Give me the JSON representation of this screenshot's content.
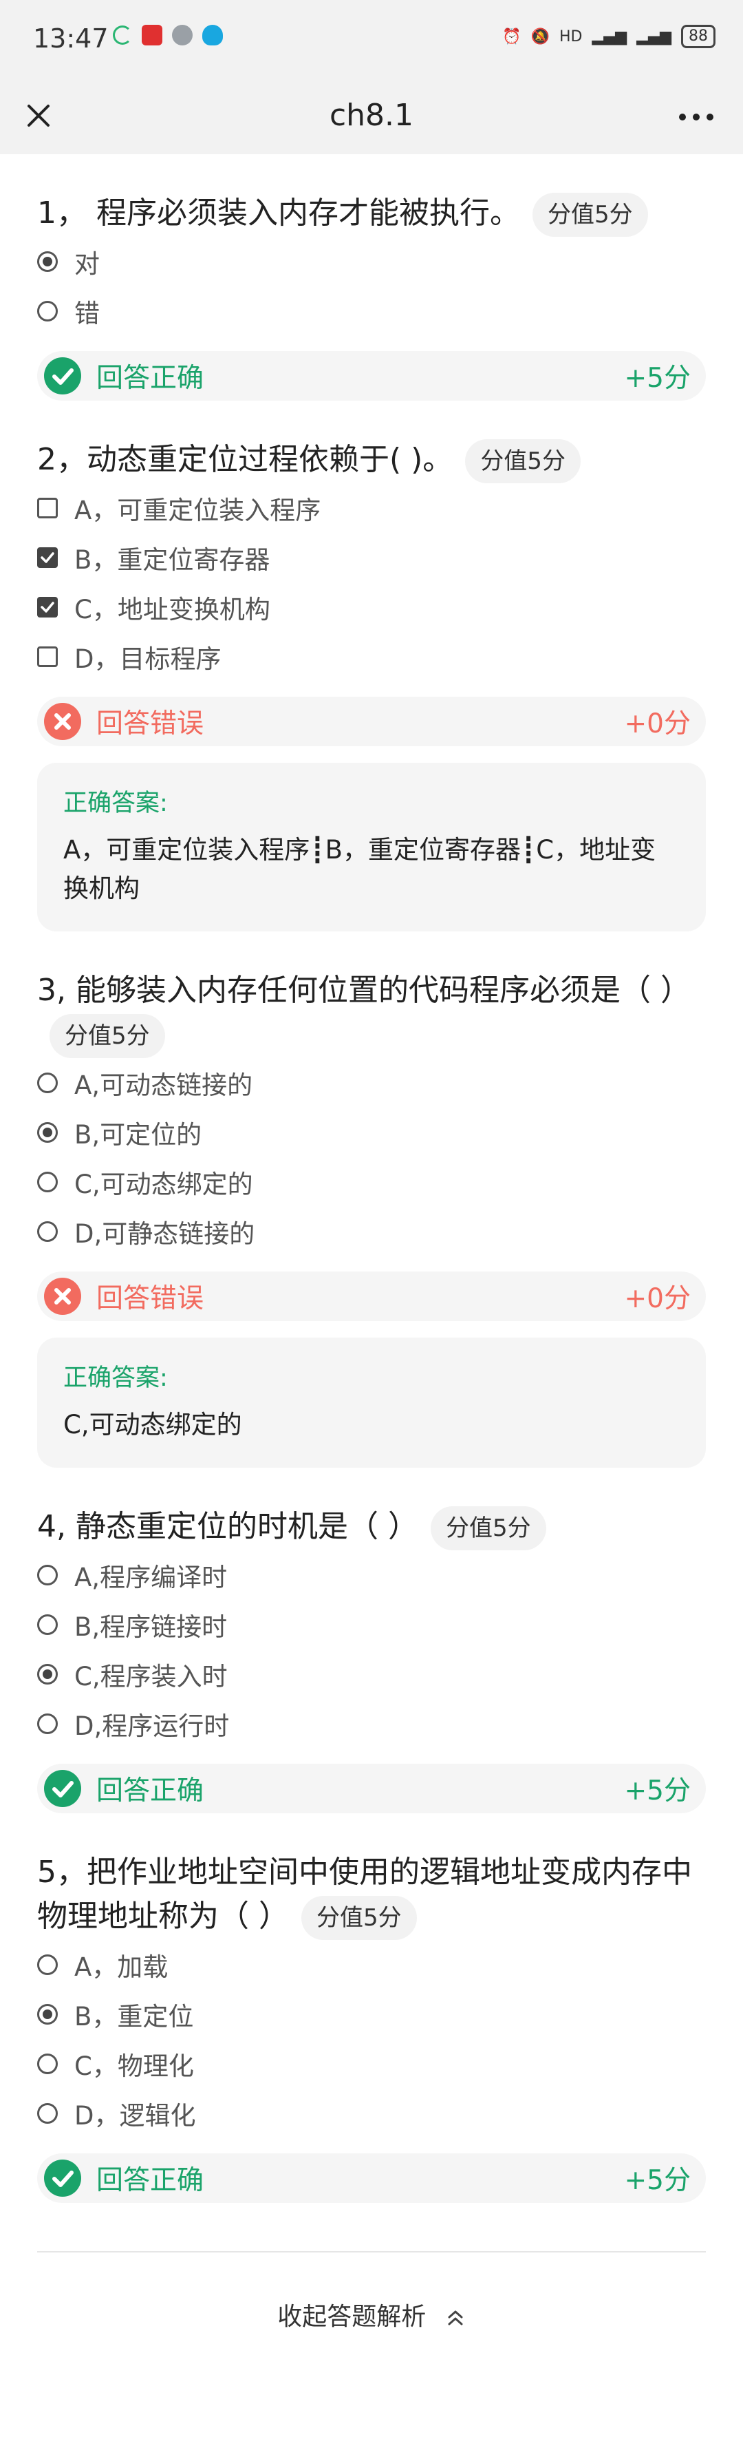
{
  "status": {
    "time": "13:47",
    "battery": "88"
  },
  "nav": {
    "title": "ch8.1"
  },
  "questions": [
    {
      "title": "1， 程序必须装入内存才能被执行。",
      "score": "分值5分",
      "options": [
        "对",
        "错"
      ],
      "result": "回答正确",
      "points": "+5分"
    },
    {
      "title": "2，动态重定位过程依赖于( )。",
      "score": "分值5分",
      "options": [
        "A，可重定位装入程序",
        "B，重定位寄存器",
        "C，地址变换机构",
        "D，目标程序"
      ],
      "result": "回答错误",
      "points": "+0分",
      "answer_label": "正确答案:",
      "answer": "A，可重定位装入程序┋B，重定位寄存器┋C，地址变换机构"
    },
    {
      "title": "3, 能够装入内存任何位置的代码程序必须是（ ）",
      "score": "分值5分",
      "options": [
        "A,可动态链接的",
        "B,可定位的",
        "C,可动态绑定的",
        "D,可静态链接的"
      ],
      "result": "回答错误",
      "points": "+0分",
      "answer_label": "正确答案:",
      "answer": "C,可动态绑定的"
    },
    {
      "title": "4, 静态重定位的时机是（ ）",
      "score": "分值5分",
      "options": [
        "A,程序编译时",
        "B,程序链接时",
        "C,程序装入时",
        "D,程序运行时"
      ],
      "result": "回答正确",
      "points": "+5分"
    },
    {
      "title": "5，把作业地址空间中使用的逻辑地址变成内存中物理地址称为（ ）",
      "score": "分值5分",
      "options": [
        "A，加载",
        "B，重定位",
        "C，物理化",
        "D，逻辑化"
      ],
      "result": "回答正确",
      "points": "+5分"
    }
  ],
  "footer": {
    "collapse_label": "收起答题解析"
  },
  "colors": {
    "correct": "#1aa36a",
    "wrong": "#f26b5f",
    "background": "#f2f2f2"
  }
}
